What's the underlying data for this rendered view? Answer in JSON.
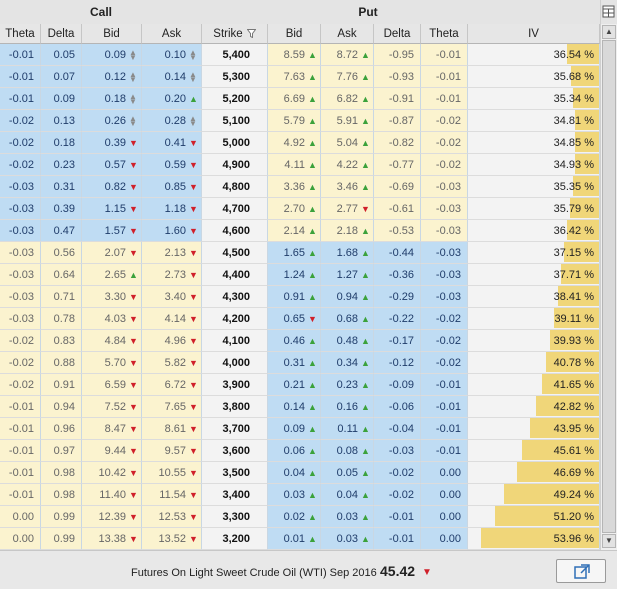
{
  "groups": {
    "call": "Call",
    "put": "Put"
  },
  "columns": [
    {
      "key": "c_theta",
      "label": "Theta"
    },
    {
      "key": "c_delta",
      "label": "Delta"
    },
    {
      "key": "c_bid",
      "label": "Bid"
    },
    {
      "key": "c_ask",
      "label": "Ask"
    },
    {
      "key": "strike",
      "label": "Strike"
    },
    {
      "key": "p_bid",
      "label": "Bid"
    },
    {
      "key": "p_ask",
      "label": "Ask"
    },
    {
      "key": "p_delta",
      "label": "Delta"
    },
    {
      "key": "p_theta",
      "label": "Theta"
    },
    {
      "key": "iv",
      "label": "IV"
    }
  ],
  "rows": [
    {
      "c_theta": "-0.01",
      "c_delta": "0.05",
      "c_bid": "0.09",
      "c_bid_t": "nc",
      "c_ask": "0.10",
      "c_ask_t": "nc",
      "strike": "5,400",
      "p_bid": "8.59",
      "p_bid_t": "up",
      "p_ask": "8.72",
      "p_ask_t": "up",
      "p_delta": "-0.95",
      "p_theta": "-0.01",
      "iv": "36.54 %",
      "iv_num": 36.54
    },
    {
      "c_theta": "-0.01",
      "c_delta": "0.07",
      "c_bid": "0.12",
      "c_bid_t": "nc",
      "c_ask": "0.14",
      "c_ask_t": "nc",
      "strike": "5,300",
      "p_bid": "7.63",
      "p_bid_t": "up",
      "p_ask": "7.76",
      "p_ask_t": "up",
      "p_delta": "-0.93",
      "p_theta": "-0.01",
      "iv": "35.68 %",
      "iv_num": 35.68
    },
    {
      "c_theta": "-0.01",
      "c_delta": "0.09",
      "c_bid": "0.18",
      "c_bid_t": "nc",
      "c_ask": "0.20",
      "c_ask_t": "up",
      "strike": "5,200",
      "p_bid": "6.69",
      "p_bid_t": "up",
      "p_ask": "6.82",
      "p_ask_t": "up",
      "p_delta": "-0.91",
      "p_theta": "-0.01",
      "iv": "35.34 %",
      "iv_num": 35.34
    },
    {
      "c_theta": "-0.02",
      "c_delta": "0.13",
      "c_bid": "0.26",
      "c_bid_t": "nc",
      "c_ask": "0.28",
      "c_ask_t": "nc",
      "strike": "5,100",
      "p_bid": "5.79",
      "p_bid_t": "up",
      "p_ask": "5.91",
      "p_ask_t": "up",
      "p_delta": "-0.87",
      "p_theta": "-0.02",
      "iv": "34.81 %",
      "iv_num": 34.81
    },
    {
      "c_theta": "-0.02",
      "c_delta": "0.18",
      "c_bid": "0.39",
      "c_bid_t": "dn",
      "c_ask": "0.41",
      "c_ask_t": "dn",
      "strike": "5,000",
      "p_bid": "4.92",
      "p_bid_t": "up",
      "p_ask": "5.04",
      "p_ask_t": "up",
      "p_delta": "-0.82",
      "p_theta": "-0.02",
      "iv": "34.85 %",
      "iv_num": 34.85
    },
    {
      "c_theta": "-0.02",
      "c_delta": "0.23",
      "c_bid": "0.57",
      "c_bid_t": "dn",
      "c_ask": "0.59",
      "c_ask_t": "dn",
      "strike": "4,900",
      "p_bid": "4.11",
      "p_bid_t": "up",
      "p_ask": "4.22",
      "p_ask_t": "up",
      "p_delta": "-0.77",
      "p_theta": "-0.02",
      "iv": "34.93 %",
      "iv_num": 34.93
    },
    {
      "c_theta": "-0.03",
      "c_delta": "0.31",
      "c_bid": "0.82",
      "c_bid_t": "dn",
      "c_ask": "0.85",
      "c_ask_t": "dn",
      "strike": "4,800",
      "p_bid": "3.36",
      "p_bid_t": "up",
      "p_ask": "3.46",
      "p_ask_t": "up",
      "p_delta": "-0.69",
      "p_theta": "-0.03",
      "iv": "35.35 %",
      "iv_num": 35.35
    },
    {
      "c_theta": "-0.03",
      "c_delta": "0.39",
      "c_bid": "1.15",
      "c_bid_t": "dn",
      "c_ask": "1.18",
      "c_ask_t": "dn",
      "strike": "4,700",
      "p_bid": "2.70",
      "p_bid_t": "up",
      "p_ask": "2.77",
      "p_ask_t": "dn",
      "p_delta": "-0.61",
      "p_theta": "-0.03",
      "iv": "35.79 %",
      "iv_num": 35.79
    },
    {
      "c_theta": "-0.03",
      "c_delta": "0.47",
      "c_bid": "1.57",
      "c_bid_t": "dn",
      "c_ask": "1.60",
      "c_ask_t": "dn",
      "strike": "4,600",
      "p_bid": "2.14",
      "p_bid_t": "up",
      "p_ask": "2.18",
      "p_ask_t": "up",
      "p_delta": "-0.53",
      "p_theta": "-0.03",
      "iv": "36.42 %",
      "iv_num": 36.42
    },
    {
      "c_theta": "-0.03",
      "c_delta": "0.56",
      "c_bid": "2.07",
      "c_bid_t": "dn",
      "c_ask": "2.13",
      "c_ask_t": "dn",
      "strike": "4,500",
      "p_bid": "1.65",
      "p_bid_t": "up",
      "p_ask": "1.68",
      "p_ask_t": "up",
      "p_delta": "-0.44",
      "p_theta": "-0.03",
      "iv": "37.15 %",
      "iv_num": 37.15
    },
    {
      "c_theta": "-0.03",
      "c_delta": "0.64",
      "c_bid": "2.65",
      "c_bid_t": "up",
      "c_ask": "2.73",
      "c_ask_t": "dn",
      "strike": "4,400",
      "p_bid": "1.24",
      "p_bid_t": "up",
      "p_ask": "1.27",
      "p_ask_t": "up",
      "p_delta": "-0.36",
      "p_theta": "-0.03",
      "iv": "37.71 %",
      "iv_num": 37.71
    },
    {
      "c_theta": "-0.03",
      "c_delta": "0.71",
      "c_bid": "3.30",
      "c_bid_t": "dn",
      "c_ask": "3.40",
      "c_ask_t": "dn",
      "strike": "4,300",
      "p_bid": "0.91",
      "p_bid_t": "up",
      "p_ask": "0.94",
      "p_ask_t": "up",
      "p_delta": "-0.29",
      "p_theta": "-0.03",
      "iv": "38.41 %",
      "iv_num": 38.41
    },
    {
      "c_theta": "-0.03",
      "c_delta": "0.78",
      "c_bid": "4.03",
      "c_bid_t": "dn",
      "c_ask": "4.14",
      "c_ask_t": "dn",
      "strike": "4,200",
      "p_bid": "0.65",
      "p_bid_t": "dn",
      "p_ask": "0.68",
      "p_ask_t": "up",
      "p_delta": "-0.22",
      "p_theta": "-0.02",
      "iv": "39.11 %",
      "iv_num": 39.11
    },
    {
      "c_theta": "-0.02",
      "c_delta": "0.83",
      "c_bid": "4.84",
      "c_bid_t": "dn",
      "c_ask": "4.96",
      "c_ask_t": "dn",
      "strike": "4,100",
      "p_bid": "0.46",
      "p_bid_t": "up",
      "p_ask": "0.48",
      "p_ask_t": "up",
      "p_delta": "-0.17",
      "p_theta": "-0.02",
      "iv": "39.93 %",
      "iv_num": 39.93
    },
    {
      "c_theta": "-0.02",
      "c_delta": "0.88",
      "c_bid": "5.70",
      "c_bid_t": "dn",
      "c_ask": "5.82",
      "c_ask_t": "dn",
      "strike": "4,000",
      "p_bid": "0.31",
      "p_bid_t": "up",
      "p_ask": "0.34",
      "p_ask_t": "up",
      "p_delta": "-0.12",
      "p_theta": "-0.02",
      "iv": "40.78 %",
      "iv_num": 40.78
    },
    {
      "c_theta": "-0.02",
      "c_delta": "0.91",
      "c_bid": "6.59",
      "c_bid_t": "dn",
      "c_ask": "6.72",
      "c_ask_t": "dn",
      "strike": "3,900",
      "p_bid": "0.21",
      "p_bid_t": "up",
      "p_ask": "0.23",
      "p_ask_t": "up",
      "p_delta": "-0.09",
      "p_theta": "-0.01",
      "iv": "41.65 %",
      "iv_num": 41.65
    },
    {
      "c_theta": "-0.01",
      "c_delta": "0.94",
      "c_bid": "7.52",
      "c_bid_t": "dn",
      "c_ask": "7.65",
      "c_ask_t": "dn",
      "strike": "3,800",
      "p_bid": "0.14",
      "p_bid_t": "up",
      "p_ask": "0.16",
      "p_ask_t": "up",
      "p_delta": "-0.06",
      "p_theta": "-0.01",
      "iv": "42.82 %",
      "iv_num": 42.82
    },
    {
      "c_theta": "-0.01",
      "c_delta": "0.96",
      "c_bid": "8.47",
      "c_bid_t": "dn",
      "c_ask": "8.61",
      "c_ask_t": "dn",
      "strike": "3,700",
      "p_bid": "0.09",
      "p_bid_t": "up",
      "p_ask": "0.11",
      "p_ask_t": "up",
      "p_delta": "-0.04",
      "p_theta": "-0.01",
      "iv": "43.95 %",
      "iv_num": 43.95
    },
    {
      "c_theta": "-0.01",
      "c_delta": "0.97",
      "c_bid": "9.44",
      "c_bid_t": "dn",
      "c_ask": "9.57",
      "c_ask_t": "dn",
      "strike": "3,600",
      "p_bid": "0.06",
      "p_bid_t": "up",
      "p_ask": "0.08",
      "p_ask_t": "up",
      "p_delta": "-0.03",
      "p_theta": "-0.01",
      "iv": "45.61 %",
      "iv_num": 45.61
    },
    {
      "c_theta": "-0.01",
      "c_delta": "0.98",
      "c_bid": "10.42",
      "c_bid_t": "dn",
      "c_ask": "10.55",
      "c_ask_t": "dn",
      "strike": "3,500",
      "p_bid": "0.04",
      "p_bid_t": "up",
      "p_ask": "0.05",
      "p_ask_t": "up",
      "p_delta": "-0.02",
      "p_theta": "0.00",
      "iv": "46.69 %",
      "iv_num": 46.69
    },
    {
      "c_theta": "-0.01",
      "c_delta": "0.98",
      "c_bid": "11.40",
      "c_bid_t": "dn",
      "c_ask": "11.54",
      "c_ask_t": "dn",
      "strike": "3,400",
      "p_bid": "0.03",
      "p_bid_t": "up",
      "p_ask": "0.04",
      "p_ask_t": "up",
      "p_delta": "-0.02",
      "p_theta": "0.00",
      "iv": "49.24 %",
      "iv_num": 49.24
    },
    {
      "c_theta": "0.00",
      "c_delta": "0.99",
      "c_bid": "12.39",
      "c_bid_t": "dn",
      "c_ask": "12.53",
      "c_ask_t": "dn",
      "strike": "3,300",
      "p_bid": "0.02",
      "p_bid_t": "up",
      "p_ask": "0.03",
      "p_ask_t": "up",
      "p_delta": "-0.01",
      "p_theta": "0.00",
      "iv": "51.20 %",
      "iv_num": 51.2
    },
    {
      "c_theta": "0.00",
      "c_delta": "0.99",
      "c_bid": "13.38",
      "c_bid_t": "dn",
      "c_ask": "13.52",
      "c_ask_t": "dn",
      "strike": "3,200",
      "p_bid": "0.01",
      "p_bid_t": "up",
      "p_ask": "0.03",
      "p_ask_t": "up",
      "p_delta": "-0.01",
      "p_theta": "0.00",
      "iv": "53.96 %",
      "iv_num": 53.96
    }
  ],
  "footer": {
    "underlying": "Futures On Light Sweet Crude Oil (WTI) Sep 2016",
    "price": "45.42",
    "price_trend": "down"
  },
  "icons": {
    "strike_filter": "filter-icon",
    "column_chooser": "column-chooser-icon",
    "detach": "detach-window-icon",
    "scroll_up": "scroll-up-icon",
    "scroll_down": "scroll-down-icon"
  },
  "colors": {
    "itm_blue": "#bfdcf3",
    "otm_yellow": "#fbf3cf",
    "iv_bar": "#f0d679",
    "up": "#3ba23b",
    "down": "#d0202a"
  }
}
